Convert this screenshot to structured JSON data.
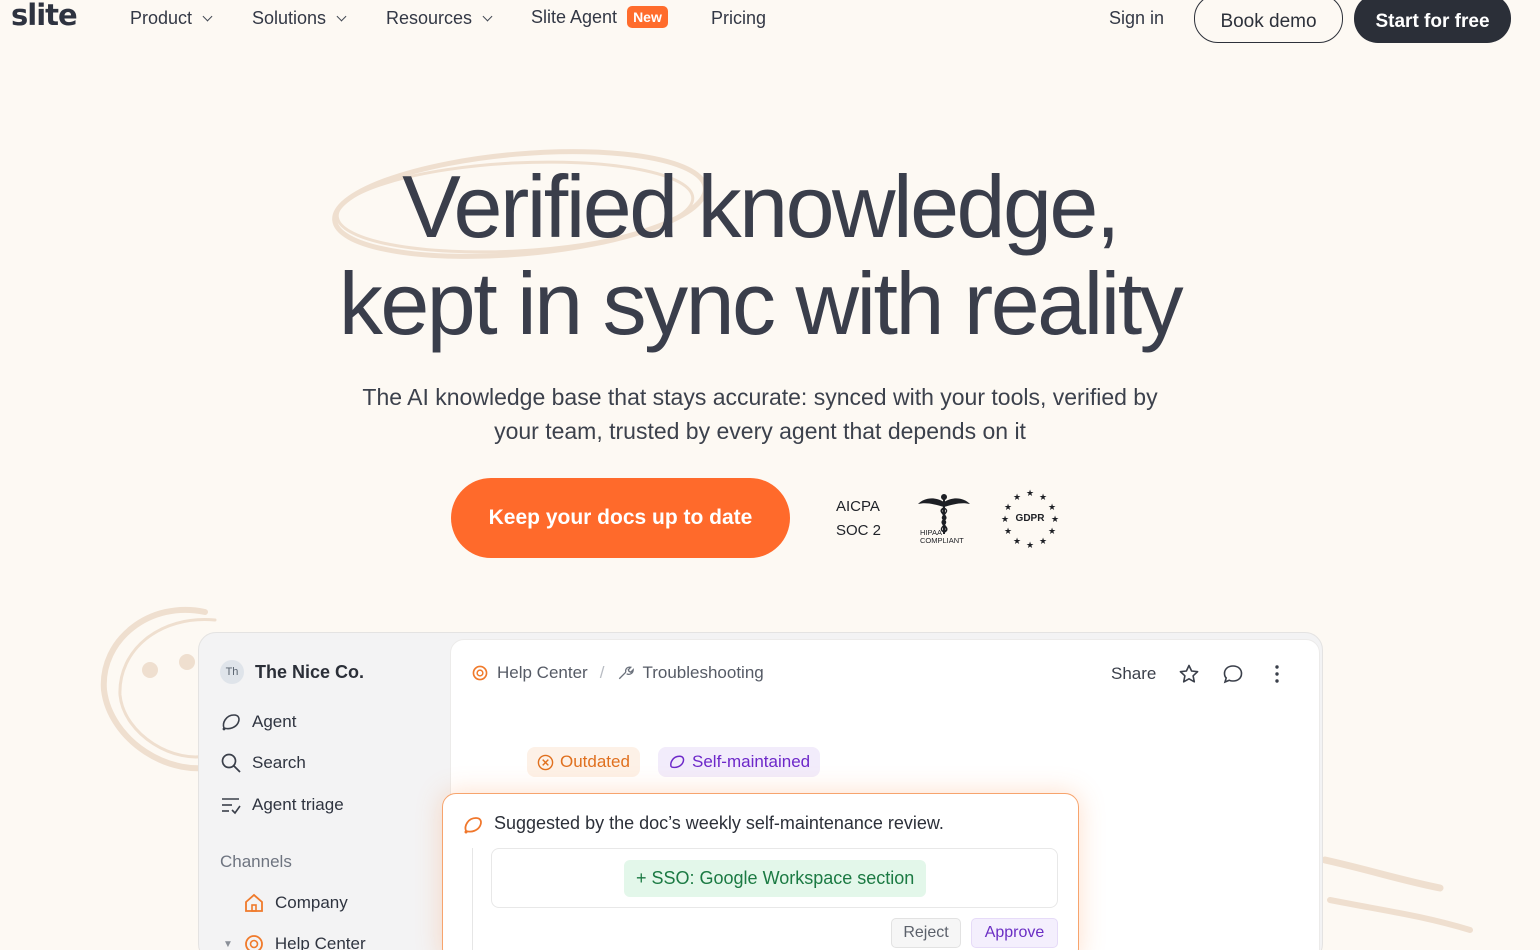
{
  "nav": {
    "logo": "slite",
    "items": [
      {
        "label": "Product",
        "has_menu": true
      },
      {
        "label": "Solutions",
        "has_menu": true
      },
      {
        "label": "Resources",
        "has_menu": true
      },
      {
        "label": "Slite Agent",
        "badge": "New"
      },
      {
        "label": "Pricing"
      }
    ],
    "signin": "Sign in",
    "book_demo": "Book demo",
    "start_free": "Start for free"
  },
  "hero": {
    "title_line1": "Verified knowledge,",
    "title_line2": "kept in sync with reality",
    "subtitle_line1": "The AI knowledge base that stays accurate: synced with your tools, verified by",
    "subtitle_line2": "your team, trusted by every agent that depends on it",
    "cta": "Keep your docs up to date"
  },
  "badges": {
    "aicpa_line1": "AICPA",
    "aicpa_line2": "SOC 2",
    "hipaa_line1": "HIPAA",
    "hipaa_line2": "COMPLIANT",
    "gdpr": "GDPR"
  },
  "app": {
    "org_initials": "Th",
    "org_name": "The Nice Co.",
    "sidebar_items": [
      {
        "label": "Agent",
        "icon": "agent-icon"
      },
      {
        "label": "Search",
        "icon": "search-icon"
      },
      {
        "label": "Agent triage",
        "icon": "triage-icon"
      }
    ],
    "channels_label": "Channels",
    "channels": [
      {
        "label": "Company",
        "icon": "home-icon"
      },
      {
        "label": "Help Center",
        "icon": "lifebuoy-icon"
      }
    ],
    "breadcrumb": [
      "Help Center",
      "Troubleshooting"
    ],
    "share": "Share",
    "tags": {
      "outdated": "Outdated",
      "self_maintained": "Self-maintained"
    },
    "suggestion": {
      "text": "Suggested by the doc’s weekly self-maintenance review.",
      "diff": "+ SSO: Google Workspace section",
      "reject": "Reject",
      "approve": "Approve"
    }
  },
  "colors": {
    "background": "#fdf9f3",
    "accent": "#ff6a2b",
    "dark": "#2b2f38",
    "purple": "#6d28c9",
    "green": "#1b7a43"
  }
}
